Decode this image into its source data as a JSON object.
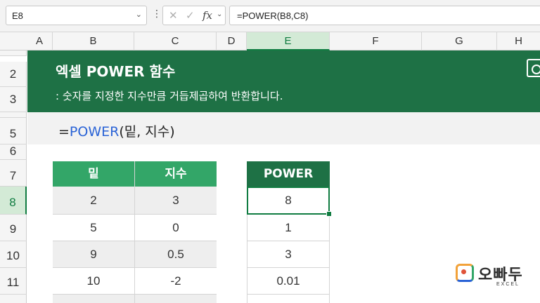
{
  "formula_bar": {
    "name_box": "E8",
    "formula": "=POWER(B8,C8)",
    "fx_label": "fx",
    "cancel_icon": "✕",
    "enter_icon": "✓"
  },
  "columns": [
    "A",
    "B",
    "C",
    "D",
    "E",
    "F",
    "G",
    "H"
  ],
  "rows": [
    "2",
    "3",
    "5",
    "6",
    "7",
    "8",
    "9",
    "10",
    "11"
  ],
  "banner": {
    "title": "엑셀 POWER 함수",
    "subtitle": ": 숫자를 지정한 지수만큼 거듭제곱하여 반환합니다."
  },
  "syntax": {
    "eq": "=",
    "fn": "POWER",
    "args": "(밑, 지수)"
  },
  "input_table": {
    "headers": [
      "밑",
      "지수"
    ],
    "rows": [
      [
        "2",
        "3"
      ],
      [
        "5",
        "0"
      ],
      [
        "9",
        "0.5"
      ],
      [
        "10",
        "-2"
      ]
    ]
  },
  "result_table": {
    "header": "POWER",
    "values": [
      "8",
      "1",
      "3",
      "0.01"
    ]
  },
  "logo": {
    "name": "오빠두",
    "sub": "EXCEL"
  },
  "colors": {
    "accent": "#1e7145",
    "header_green": "#33a668",
    "selection": "#107c41",
    "function_blue": "#2a63d6"
  }
}
